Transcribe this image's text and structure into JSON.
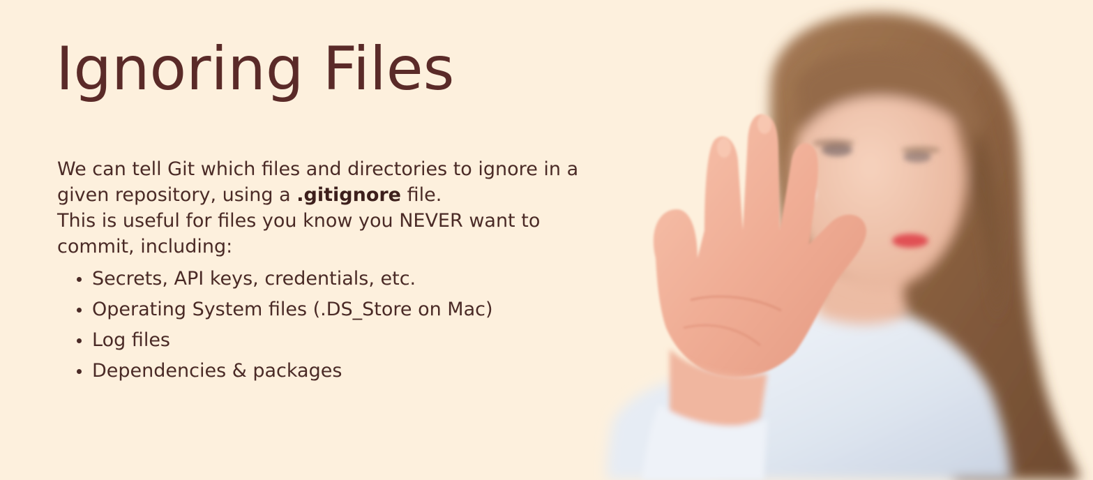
{
  "slide": {
    "title": "Ignoring Files",
    "intro_before_bold": "We can tell Git which files and directories to ignore in a given repository, using a ",
    "intro_bold": ".gitignore",
    "intro_after_bold": " file.",
    "intro_second": "This is useful for files you know you NEVER want to commit, including:",
    "bullets": [
      "Secrets, API keys, credentials, etc.",
      "Operating System files (.DS_Store on Mac)",
      "Log files",
      "Dependencies & packages"
    ]
  },
  "colors": {
    "background": "#fdf0dd",
    "title": "#5a2a28",
    "text": "#4a2a26"
  }
}
